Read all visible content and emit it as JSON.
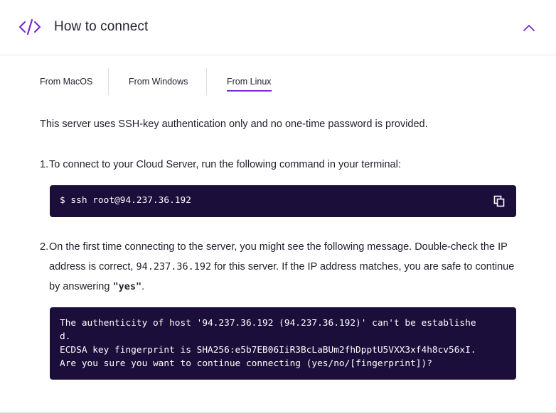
{
  "header": {
    "title": "How to connect",
    "icon": "code-icon",
    "collapse_icon": "chevron-up-icon",
    "accent_color": "#7b2bd1"
  },
  "tabs": [
    {
      "label": "From MacOS",
      "active": false
    },
    {
      "label": "From Windows",
      "active": false
    },
    {
      "label": "From Linux",
      "active": true
    }
  ],
  "intro": "This server uses SSH-key authentication only and no one-time password is provided.",
  "step1": {
    "num": "1.",
    "text": "To connect to your Cloud Server, run the following command in your terminal:",
    "command": "$ ssh root@94.237.36.192",
    "copy_icon": "copy-icon"
  },
  "step2": {
    "num": "2.",
    "text_a": "On the first time connecting to the server, you might see the following message. Double-check the IP address is correct, ",
    "ip": "94.237.36.192",
    "text_b": " for this server. If the IP address matches, you are safe to continue by answering ",
    "answer": "\"yes\"",
    "text_c": ".",
    "output": [
      "The authenticity of host '94.237.36.192 (94.237.36.192)' can't be establishe",
      "d.",
      "ECDSA key fingerprint is SHA256:e5b7EB06IiR3BcLaBUm2fhDpptU5VXX3xf4h8cv56xI.",
      "Are you sure you want to continue connecting (yes/no/[fingerprint])?"
    ]
  },
  "code_bg_color": "#1c0e3a"
}
